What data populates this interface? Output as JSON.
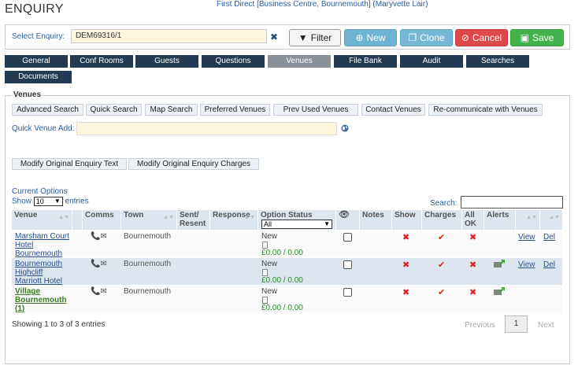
{
  "page": {
    "title": "ENQUIRY",
    "context": "First Direct [Business Centre, Bournemouth] (Maryvette Lair)"
  },
  "enquiry_bar": {
    "label": "Select Enquiry:",
    "value": "DEM69316/1",
    "clear_icon": "close-icon",
    "buttons": {
      "filter": "Filter",
      "new": "New",
      "clone": "Clone",
      "cancel": "Cancel",
      "save": "Save"
    },
    "colors": {
      "new": "#6fb3d3",
      "clone": "#76b7d6",
      "cancel": "#de4848",
      "save": "#42b34c"
    }
  },
  "tabs": [
    "General",
    "Conf Rooms",
    "Guests",
    "Questions",
    "Venues",
    "File Bank",
    "Audit",
    "Searches",
    "Documents"
  ],
  "active_tab": "Venues",
  "venues": {
    "legend": "Venues",
    "subtabs": [
      "Advanced Search",
      "Quick Search",
      "Map Search",
      "Preferred Venues",
      "Prev Used Venues",
      "Contact Venues",
      "Re-communicate with Venues"
    ],
    "quick_add_label": "Quick Venue Add:",
    "modify_text": "Modify Original Enquiry Text",
    "modify_charges": "Modify Original Enquiry Charges",
    "current_options": "Current Options",
    "show_label": "Show",
    "entries_label": "entries",
    "page_length": "10",
    "search_label": "Search:",
    "columns": [
      "Venue",
      "Comms",
      "Town",
      "Sent/ Resent",
      "Response",
      "Option Status",
      "Notes",
      "Show",
      "Charges",
      "All OK",
      "Alerts"
    ],
    "status_filter": "All",
    "rows": [
      {
        "venue": "Marsham Court Hotel Bournemouth",
        "town": "Bournemouth",
        "status": "New",
        "amount": "£0.00 / 0.00",
        "highlight": false
      },
      {
        "venue": "Bournemouth Highcliff Marriott Hotel",
        "town": "Bournemouth",
        "status": "New",
        "amount": "£0.00 / 0.00",
        "highlight": false
      },
      {
        "venue": "Village Bournemouth (1)",
        "town": "Bournemouth",
        "status": "New",
        "amount": "£0.00 / 0.00",
        "highlight": true
      }
    ],
    "view_label": "View",
    "del_label": "Del",
    "showing": "Showing 1 to 3 of 3 entries",
    "pagination": {
      "previous": "Previous",
      "current": "1",
      "next": "Next"
    }
  }
}
